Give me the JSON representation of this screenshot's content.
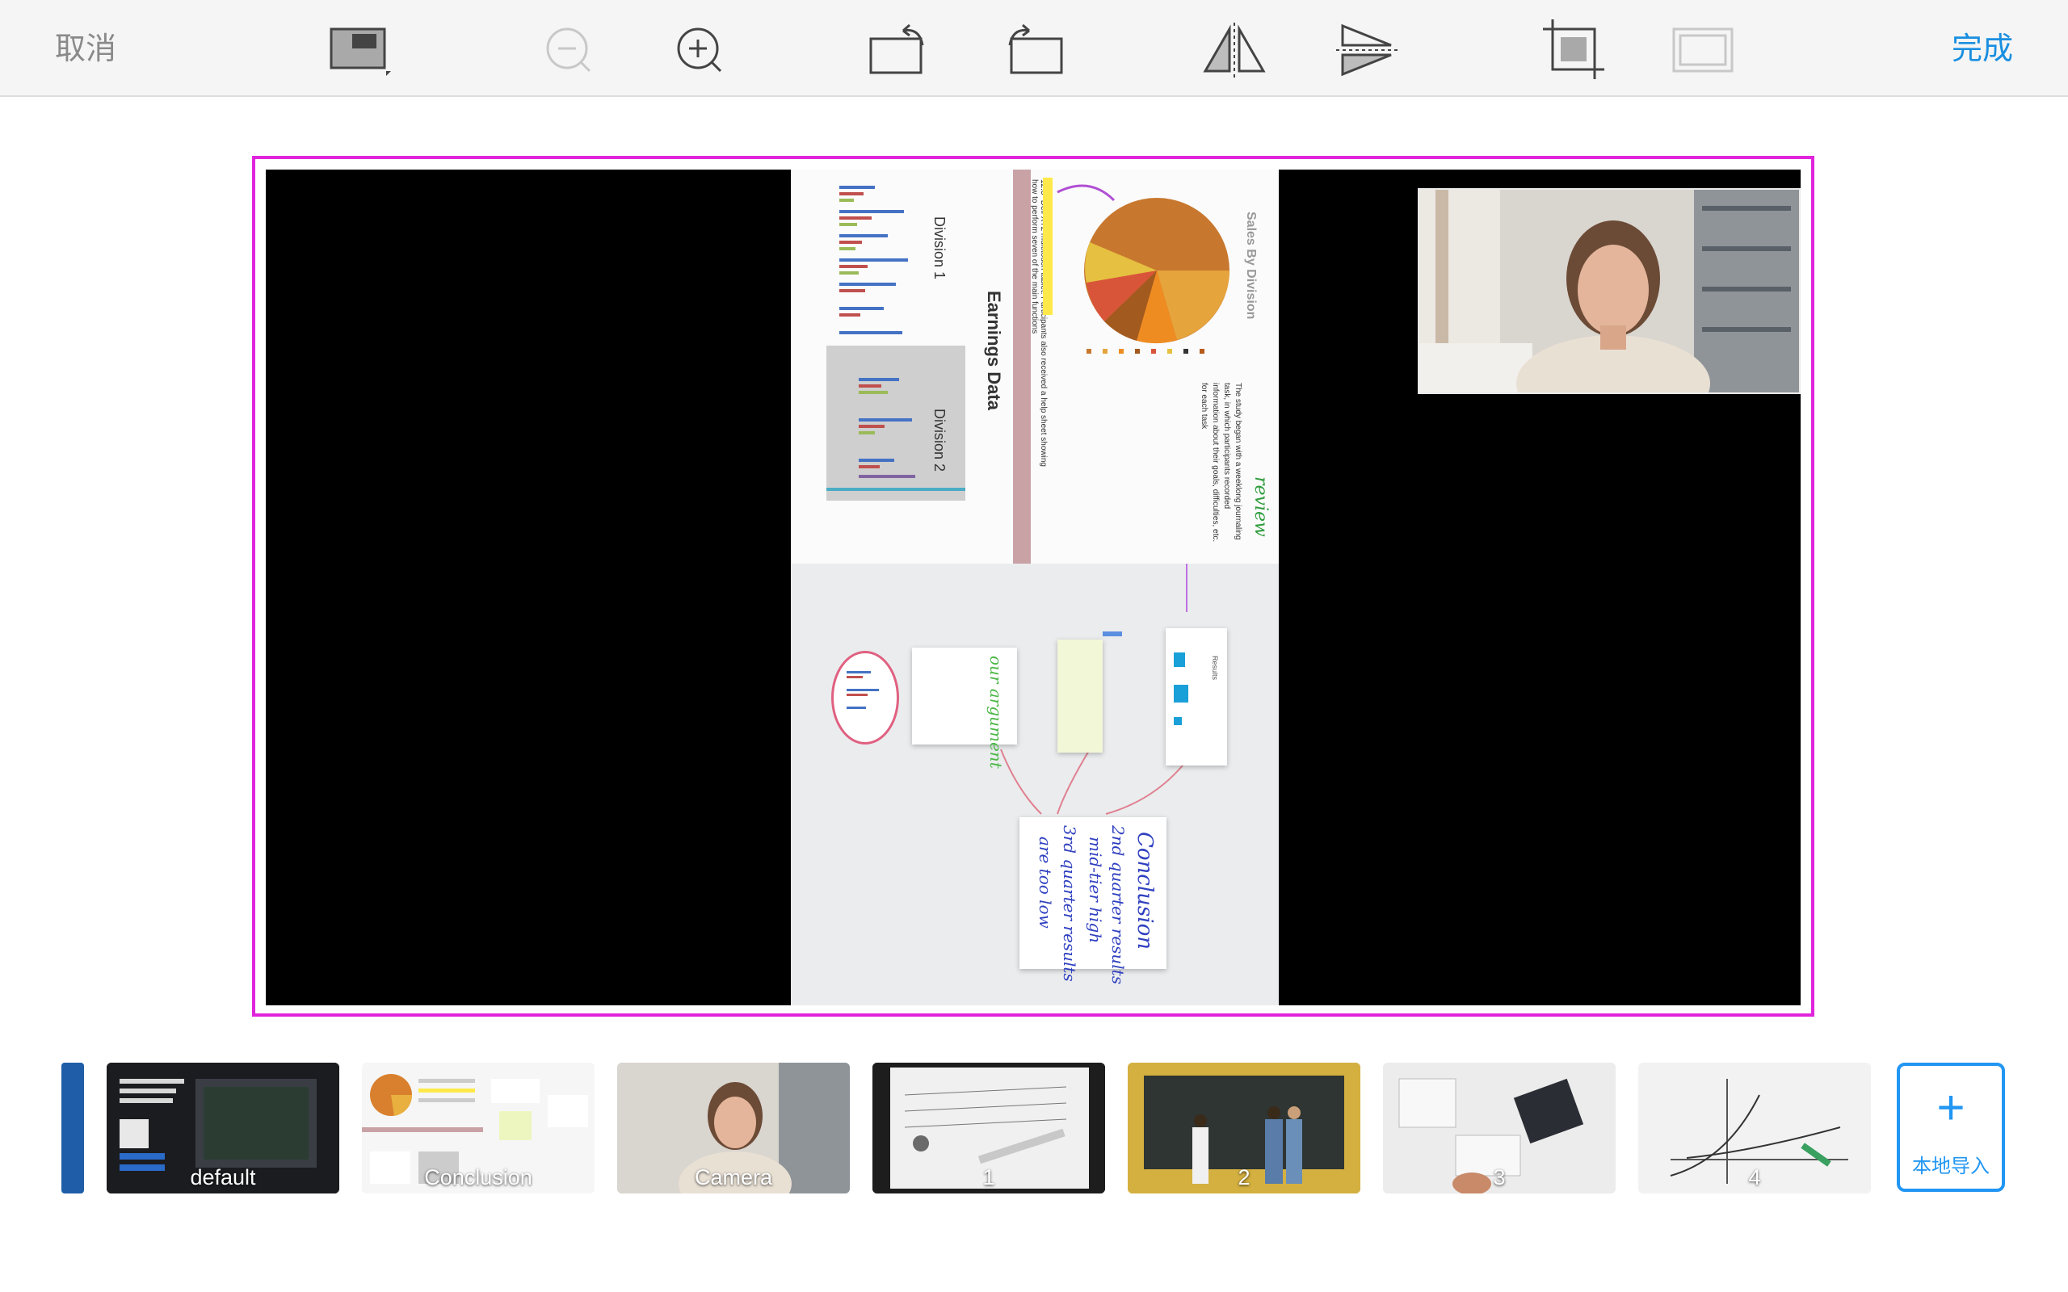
{
  "toolbar": {
    "cancel_label": "取消",
    "done_label": "完成",
    "icons": [
      "layout-icon",
      "zoom-out-icon",
      "zoom-in-icon",
      "rotate-left-icon",
      "rotate-right-icon",
      "flip-horizontal-icon",
      "flip-vertical-icon",
      "crop-icon",
      "frame-icon"
    ]
  },
  "preview": {
    "screen_share": {
      "chart_title": "Sales By Division",
      "section_title": "Earnings Data",
      "division_1": "Division 1",
      "division_2": "Division 2",
      "review_note": "review",
      "body_text": "The study began with a weeklong journaling task, in which participants recorded information about their goals, difficulties, etc. for each task",
      "caption": "12.3\" Dell XT2 multitouch tablet. Participants also received a help sheet showing how to perform seven of the main functions",
      "conclusion_note": {
        "title": "Conclusion",
        "line1": "2nd quarter results",
        "line2": "mid-tier high",
        "line3": "3rd quarter results",
        "line4": "are too low"
      },
      "argument_note": "our argument",
      "results_label": "Results"
    },
    "camera_overlay": true
  },
  "scenes": [
    {
      "label": ""
    },
    {
      "label": "default"
    },
    {
      "label": "Conclusion"
    },
    {
      "label": "Camera"
    },
    {
      "label": "1"
    },
    {
      "label": "2"
    },
    {
      "label": "3"
    },
    {
      "label": "4"
    }
  ],
  "import_button": {
    "icon": "+",
    "label": "本地导入"
  },
  "colors": {
    "accent": "#1a8fe0",
    "selection_border": "#e024dc",
    "import_border": "#2196f3"
  }
}
